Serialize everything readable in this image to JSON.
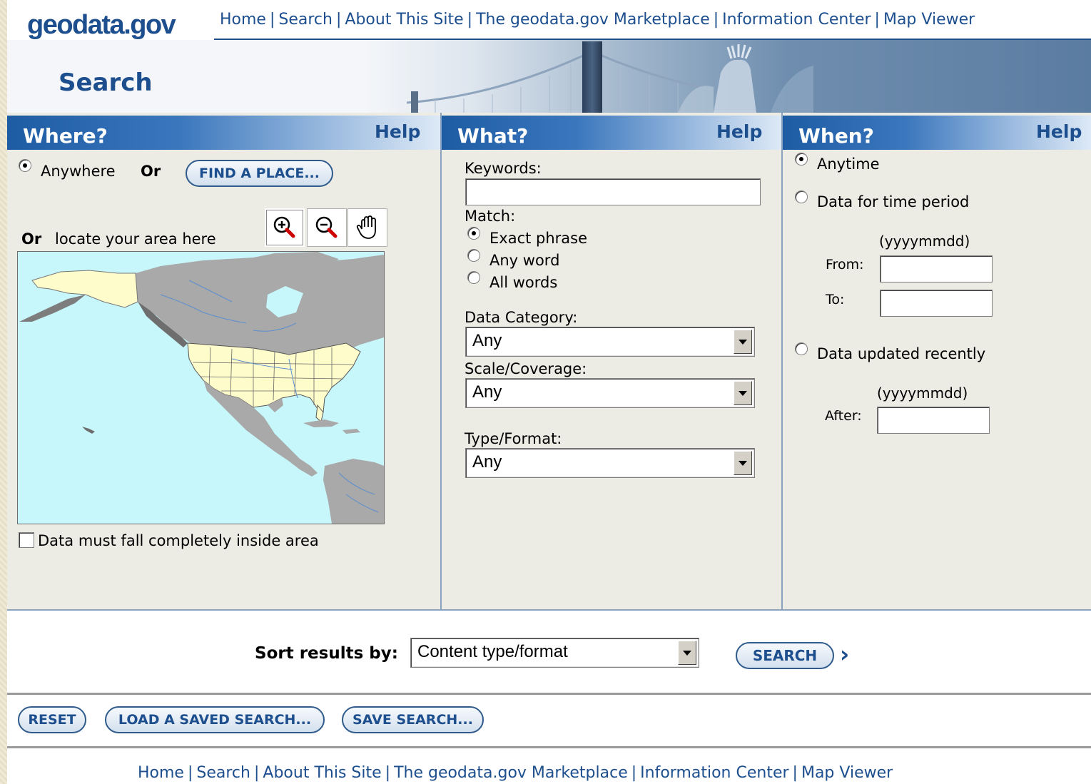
{
  "header": {
    "logo": "geodata.gov",
    "nav": [
      "Home",
      "Search",
      "About This Site",
      "The geodata.gov Marketplace",
      "Information Center",
      "Map Viewer"
    ],
    "page_title": "Search"
  },
  "where": {
    "title": "Where?",
    "help": "Help",
    "anywhere_label": "Anywhere",
    "or1": "Or",
    "find_place_button": "FIND A PLACE...",
    "or2": "Or",
    "locate_label": "locate your area here",
    "tools": [
      "zoom-in-icon",
      "zoom-out-icon",
      "pan-hand-icon"
    ],
    "checkbox_label": "Data must fall completely inside area"
  },
  "what": {
    "title": "What?",
    "help": "Help",
    "keywords_label": "Keywords:",
    "keywords_value": "",
    "match_label": "Match:",
    "match_options": [
      "Exact phrase",
      "Any word",
      "All words"
    ],
    "match_selected": "Exact phrase",
    "category_label": "Data Category:",
    "category_value": "Any",
    "scale_label": "Scale/Coverage:",
    "scale_value": "Any",
    "type_label": "Type/Format:",
    "type_value": "Any"
  },
  "when": {
    "title": "When?",
    "help": "Help",
    "anytime_label": "Anytime",
    "period_label": "Data for time period",
    "date_format_1": "(yyyymmdd)",
    "from_label": "From:",
    "from_value": "",
    "to_label": "To:",
    "to_value": "",
    "updated_label": "Data updated recently",
    "date_format_2": "(yyyymmdd)",
    "after_label": "After:",
    "after_value": ""
  },
  "sort": {
    "label": "Sort results by:",
    "value": "Content type/format",
    "search_button": "SEARCH",
    "arrow": "›"
  },
  "actions": {
    "reset": "RESET",
    "load": "LOAD A SAVED SEARCH...",
    "save": "SAVE SEARCH..."
  },
  "footer": {
    "nav": [
      "Home",
      "Search",
      "About This Site",
      "The geodata.gov Marketplace",
      "Information Center",
      "Map Viewer"
    ]
  },
  "colors": {
    "brand_blue": "#1d4f8e",
    "header_gradient_start": "#1d5ba3",
    "panel_bg": "#ecebe4",
    "map_ocean": "#c7f6fb",
    "map_land": "#a9a9a9",
    "map_us": "#fffccc"
  }
}
